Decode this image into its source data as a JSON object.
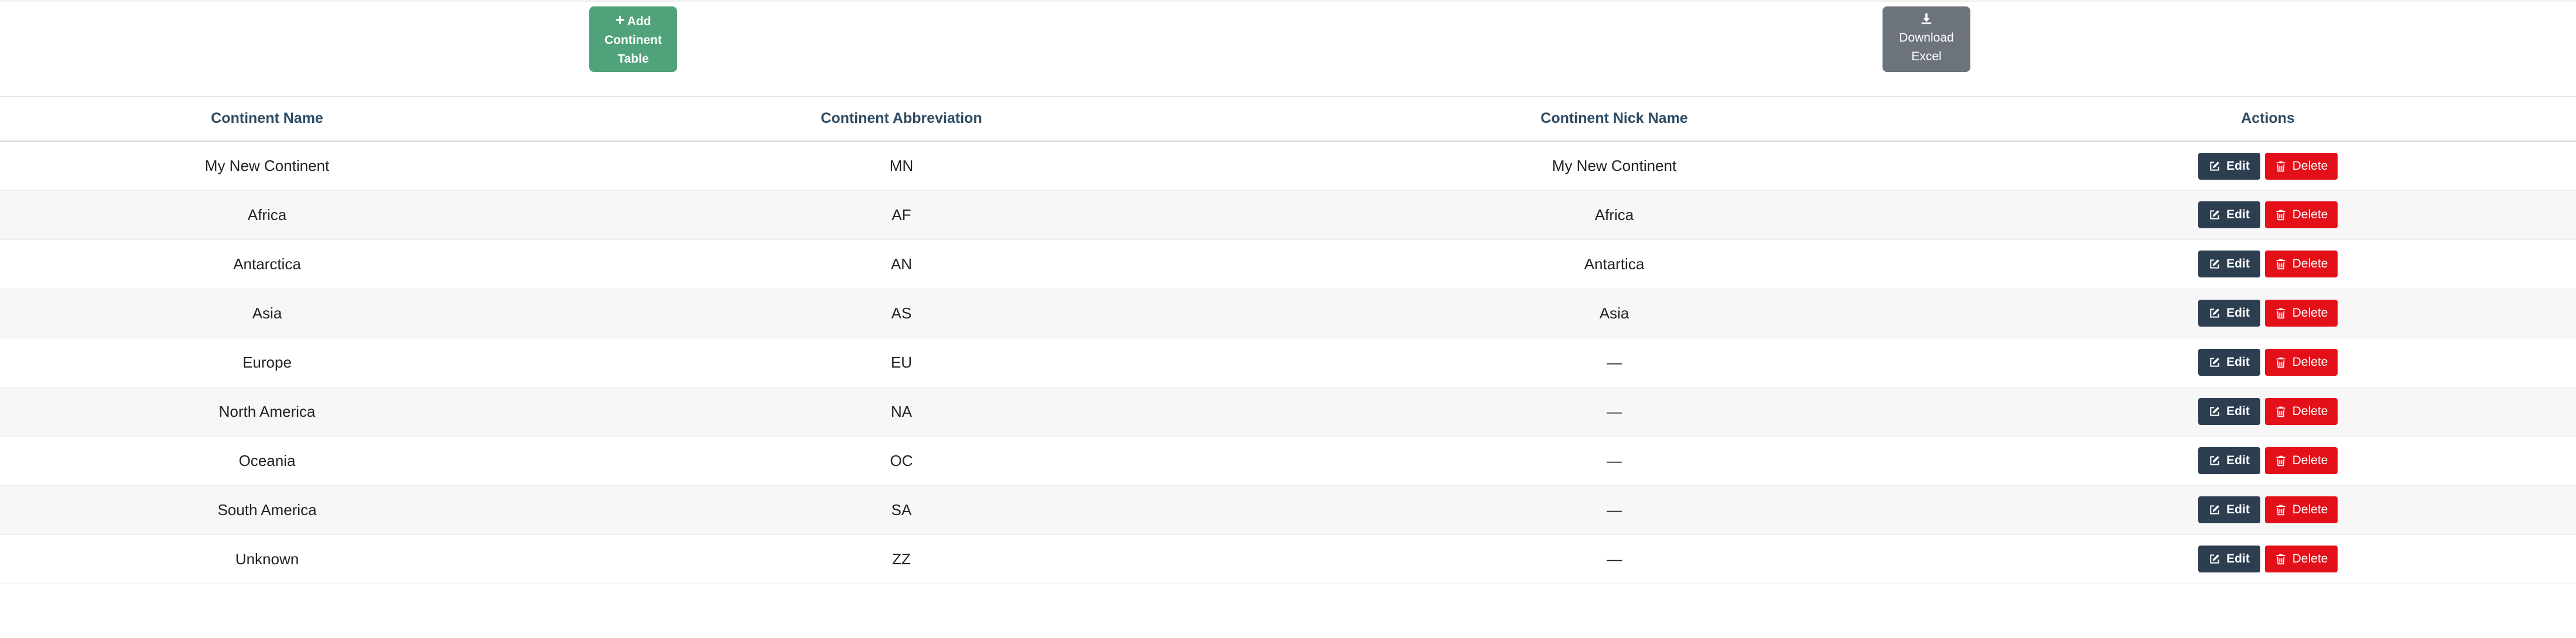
{
  "toolbar": {
    "add_line1": "Add",
    "add_line2": "Continent",
    "add_line3": "Table",
    "download_line1": "Download",
    "download_line2": "Excel"
  },
  "table": {
    "columns": [
      "Continent Name",
      "Continent Abbreviation",
      "Continent Nick Name",
      "Actions"
    ],
    "edit_label": "Edit",
    "delete_label": "Delete",
    "rows": [
      {
        "name": "My New Continent",
        "abbr": "MN",
        "nick": "My New Continent"
      },
      {
        "name": "Africa",
        "abbr": "AF",
        "nick": "Africa"
      },
      {
        "name": "Antarctica",
        "abbr": "AN",
        "nick": "Antartica"
      },
      {
        "name": "Asia",
        "abbr": "AS",
        "nick": "Asia"
      },
      {
        "name": "Europe",
        "abbr": "EU",
        "nick": "—"
      },
      {
        "name": "North America",
        "abbr": "NA",
        "nick": "—"
      },
      {
        "name": "Oceania",
        "abbr": "OC",
        "nick": "—"
      },
      {
        "name": "South America",
        "abbr": "SA",
        "nick": "—"
      },
      {
        "name": "Unknown",
        "abbr": "ZZ",
        "nick": "—"
      }
    ]
  },
  "colors": {
    "add_button": "#4fa27a",
    "download_button": "#6d737b",
    "edit_button": "#2c3e50",
    "delete_button": "#e3101a",
    "header_text": "#2d4b63"
  },
  "icons": {
    "add": "plus-icon",
    "download": "download-icon",
    "edit": "edit-icon",
    "delete": "trash-icon"
  }
}
